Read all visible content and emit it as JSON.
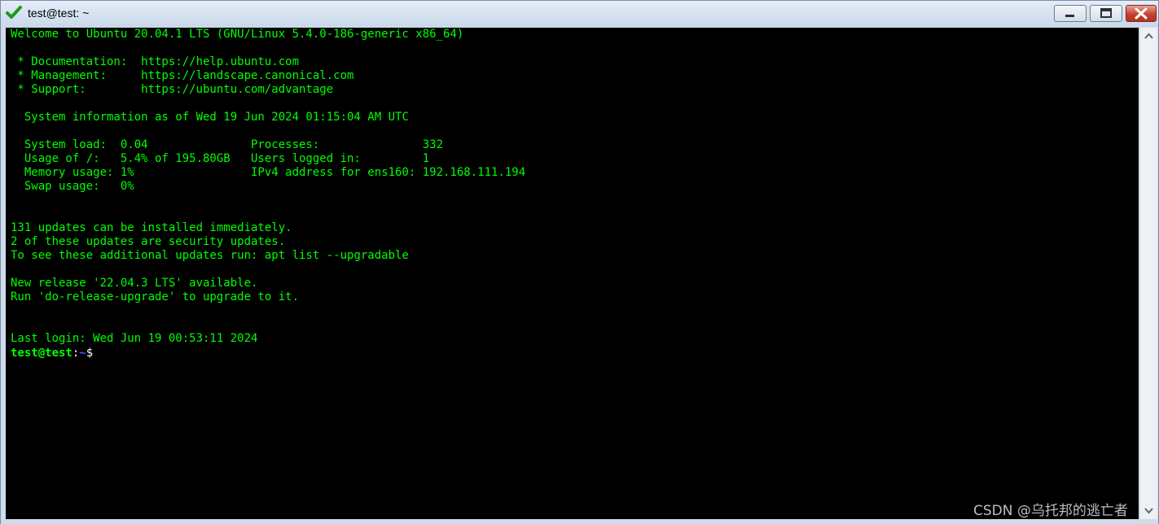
{
  "window": {
    "title": "test@test: ~",
    "app_icon": "green-check-icon",
    "controls": {
      "minimize_icon": "minimize-icon",
      "maximize_icon": "maximize-icon",
      "close_icon": "close-icon"
    }
  },
  "terminal": {
    "colors": {
      "text": "#00ff00",
      "background": "#000000",
      "path": "#3b5bff"
    },
    "lines": [
      "Welcome to Ubuntu 20.04.1 LTS (GNU/Linux 5.4.0-186-generic x86_64)",
      " * Documentation:  https://help.ubuntu.com",
      " * Management:     https://landscape.canonical.com",
      " * Support:        https://ubuntu.com/advantage",
      "  System information as of Wed 19 Jun 2024 01:15:04 AM UTC",
      "  System load:  0.04               Processes:               332",
      "  Usage of /:   5.4% of 195.80GB   Users logged in:         1",
      "  Memory usage: 1%                 IPv4 address for ens160: 192.168.111.194",
      "  Swap usage:   0%",
      "131 updates can be installed immediately.",
      "2 of these updates are security updates.",
      "To see these additional updates run: apt list --upgradable",
      "New release '22.04.3 LTS' available.",
      "Run 'do-release-upgrade' to upgrade to it.",
      "Last login: Wed Jun 19 00:53:11 2024"
    ],
    "prompt": {
      "user_host": "test@test",
      "colon": ":",
      "path": "~",
      "symbol": "$"
    }
  },
  "scrollbar": {
    "up_icon": "scroll-up-arrow-icon",
    "down_icon": "scroll-down-arrow-icon"
  },
  "watermark": "CSDN @乌托邦的逃亡者"
}
